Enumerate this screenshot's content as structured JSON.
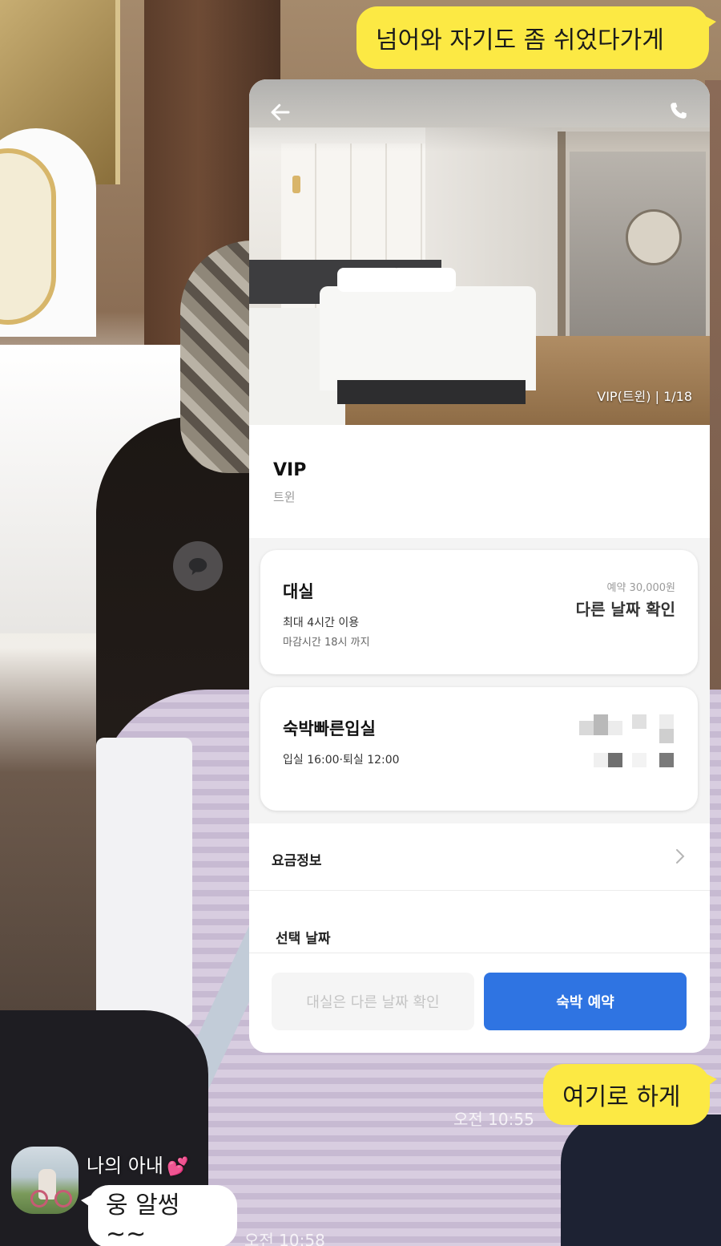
{
  "chat": {
    "messages": [
      {
        "from": "me",
        "text": "넘어와 자기도 좀 쉬었다가게"
      },
      {
        "from": "me",
        "text": "여기로 하게",
        "time": "오전 10:55"
      },
      {
        "from": "them",
        "sender": "나의 아내",
        "sender_emoji": "💕",
        "text": "웅 알썽~~",
        "time": "오전 10:58"
      }
    ],
    "colors": {
      "my_bubble": "#fce944",
      "their_bubble": "#ffffff"
    }
  },
  "card": {
    "photo_caption": "VIP(트윈) | 1/18",
    "room_name": "VIP",
    "room_type": "트윈",
    "options": {
      "rent": {
        "title": "대실",
        "line1": "최대 4시간 이용",
        "line2": "마감시간 18시 까지",
        "price_note": "예약 30,000원",
        "price_main": "다른 날짜 확인"
      },
      "stay": {
        "title": "숙박빠른입실",
        "line1": "입실 16:00·퇴실 12:00"
      }
    },
    "rate_info_label": "요금정보",
    "selected_date_label": "선택 날짜",
    "buttons": {
      "rent_disabled": "대실은 다른 날짜 확인",
      "stay_book": "숙박 예약"
    },
    "accent_color": "#2f74e2"
  }
}
